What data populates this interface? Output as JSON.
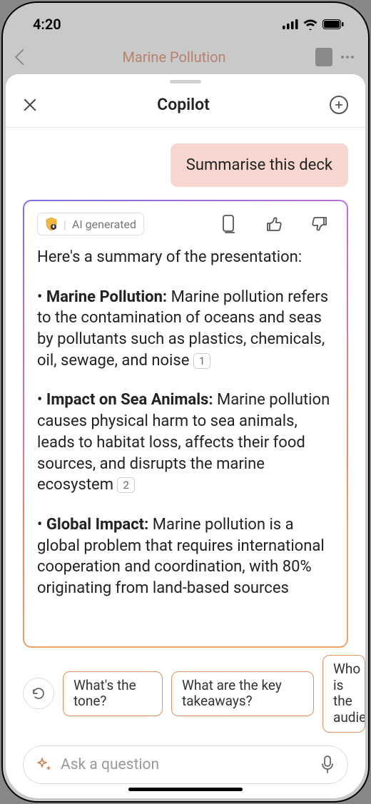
{
  "status": {
    "time": "4:20"
  },
  "app": {
    "doc_title": "Marine Pollution"
  },
  "sheet": {
    "title": "Copilot",
    "user_message": "Summarise this deck",
    "ai_badge_label": "AI generated",
    "response_intro": "Here's a summary of the presentation:",
    "bullets": [
      {
        "title": "Marine Pollution:",
        "body": "Marine pollution refers to the contamination of oceans and seas by pollutants such as plastics, chemicals, oil, sewage, and noise",
        "cite": "1"
      },
      {
        "title": "Impact on Sea Animals:",
        "body": "Marine pollution causes physical harm to sea animals, leads to habitat loss, affects their food sources, and disrupts the marine ecosystem",
        "cite": "2"
      },
      {
        "title": "Global Impact:",
        "body": "Marine pollution is a global problem that requires international cooperation and coordination, with 80% originating from land-based sources",
        "cite": ""
      }
    ],
    "suggestions": [
      "What's the tone?",
      "What are the key takeaways?",
      "Who is the audience?"
    ],
    "input_placeholder": "Ask a question"
  }
}
